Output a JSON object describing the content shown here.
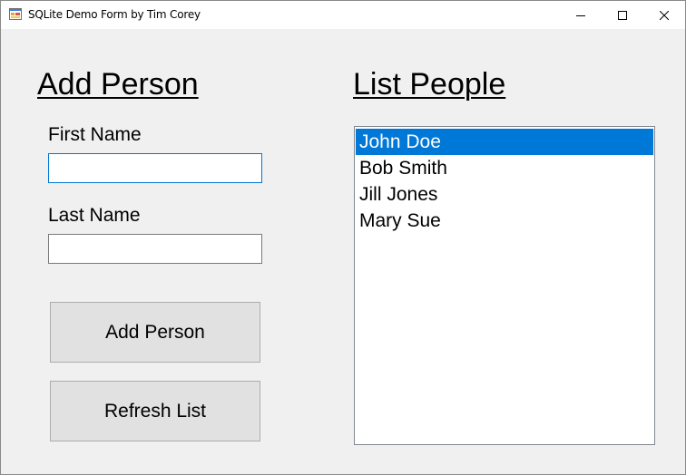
{
  "window": {
    "title": "SQLite Demo Form by Tim Corey",
    "icon": "form-app-icon",
    "controls": {
      "minimize_icon": "minimize-icon",
      "maximize_icon": "maximize-icon",
      "close_icon": "close-icon"
    }
  },
  "add_person": {
    "heading": "Add Person",
    "first_name_label": "First Name",
    "first_name_value": "",
    "last_name_label": "Last Name",
    "last_name_value": "",
    "add_button_label": "Add Person",
    "refresh_button_label": "Refresh List"
  },
  "list_people": {
    "heading": "List People",
    "items": [
      {
        "name": "John Doe",
        "selected": true
      },
      {
        "name": "Bob Smith",
        "selected": false
      },
      {
        "name": "Jill Jones",
        "selected": false
      },
      {
        "name": "Mary Sue",
        "selected": false
      }
    ]
  },
  "colors": {
    "selection": "#0078d7",
    "form_background": "#f0f0f0",
    "button_face": "#e1e1e1"
  }
}
